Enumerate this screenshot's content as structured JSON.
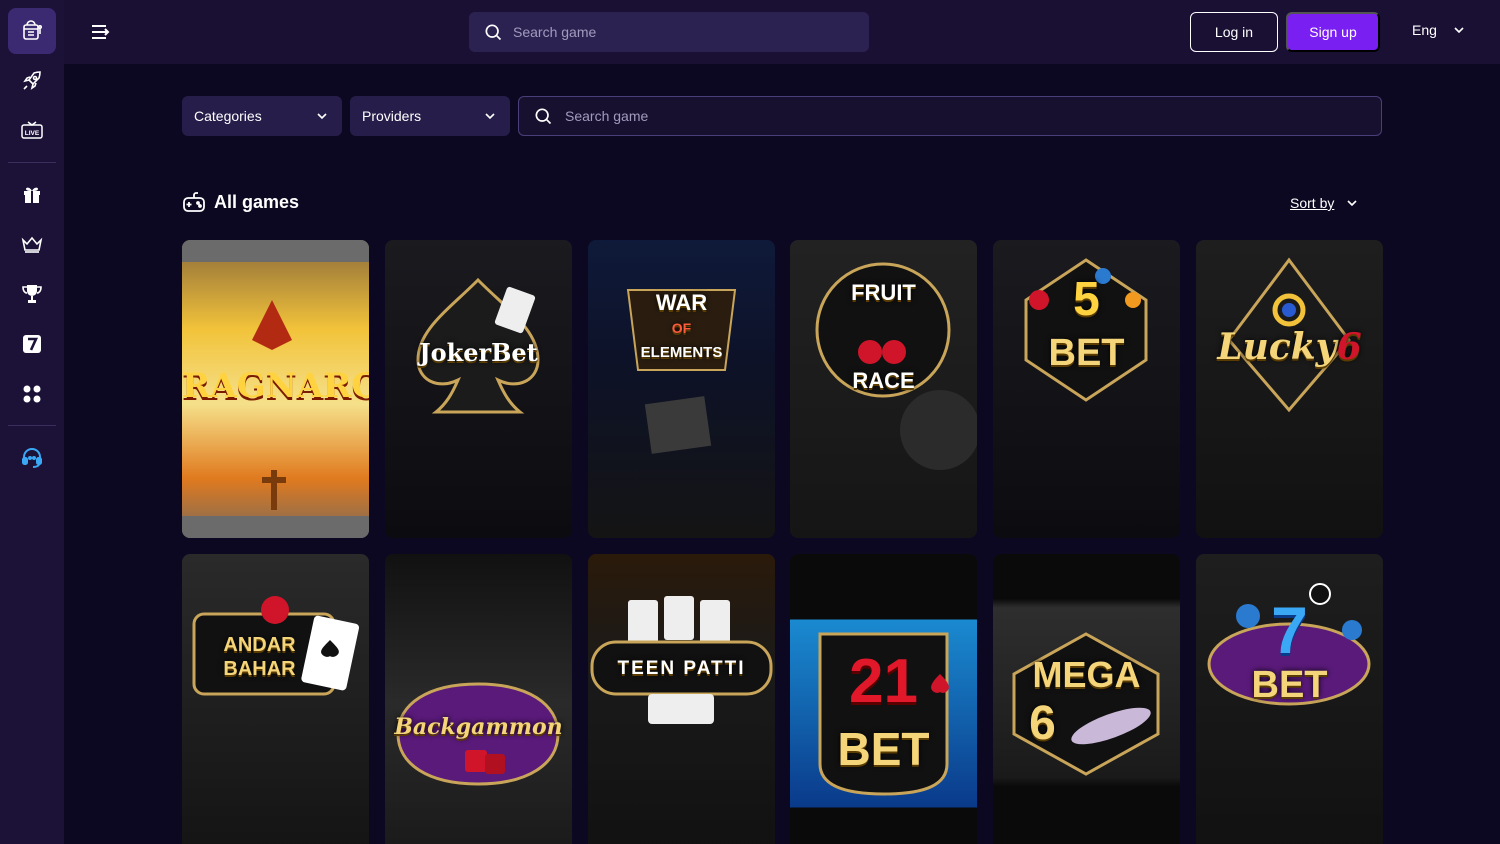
{
  "topbar": {
    "search_placeholder": "Search game",
    "login_label": "Log in",
    "signup_label": "Sign up",
    "language": "Eng"
  },
  "sidebar": {
    "items": [
      {
        "icon": "casino-slot-icon",
        "active": true
      },
      {
        "icon": "rocket-icon"
      },
      {
        "icon": "live-icon",
        "label": "LIVE"
      },
      {
        "icon": "gift-icon"
      },
      {
        "icon": "crown-icon"
      },
      {
        "icon": "trophy-icon"
      },
      {
        "icon": "seven-icon",
        "label": "7"
      },
      {
        "icon": "apps-grid-icon"
      },
      {
        "icon": "support-headset-icon"
      }
    ]
  },
  "filters": {
    "categories_label": "Categories",
    "providers_label": "Providers",
    "search_placeholder": "Search game"
  },
  "section": {
    "title": "All games",
    "sort_label": "Sort by"
  },
  "games": [
    {
      "title": "RAGNAROK"
    },
    {
      "title": "JokerBet"
    },
    {
      "title": "WAR",
      "title2": "OF",
      "title3": "ELEMENTS"
    },
    {
      "title": "FRUIT",
      "title2": "RACE"
    },
    {
      "title": "5",
      "title2": "BET"
    },
    {
      "title": "Lucky",
      "title2": "6"
    },
    {
      "title": "ANDAR",
      "title2": "BAHAR"
    },
    {
      "title": "Backgammon"
    },
    {
      "title": "TEEN PATTI"
    },
    {
      "title": "21",
      "title2": "BET"
    },
    {
      "title": "MEGA",
      "title2": "6"
    },
    {
      "title": "7",
      "title2": "BET"
    }
  ],
  "colors": {
    "page_bg": "#0d0821",
    "sidebar_bg": "#1c1238",
    "topbar_bg": "#1a1034",
    "accent": "#7a1ff2"
  }
}
